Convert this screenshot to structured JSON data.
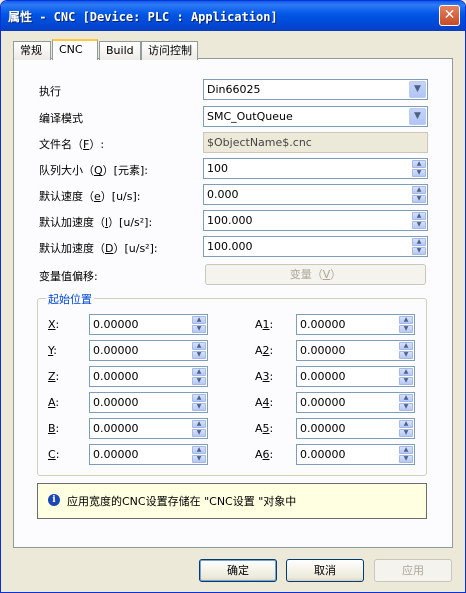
{
  "window": {
    "title": "属性 - CNC [Device: PLC : Application]",
    "close": "✕"
  },
  "tabs": [
    {
      "label": "常规",
      "active": false
    },
    {
      "label": "CNC",
      "active": true
    },
    {
      "label": "Build",
      "active": false
    },
    {
      "label": "访问控制",
      "active": false
    }
  ],
  "form": {
    "execute": {
      "label": "执行",
      "value": "Din66025"
    },
    "compile_mode": {
      "label": "编译模式",
      "value": "SMC_OutQueue"
    },
    "filename": {
      "label_pre": "文件名（",
      "label_u": "F",
      "label_post": "）:",
      "value": "$ObjectName$.cnc"
    },
    "queue_size": {
      "label_pre": "队列大小（",
      "label_u": "Q",
      "label_post": "）[元素]:",
      "value": "100"
    },
    "default_speed": {
      "label_pre": "默认速度（",
      "label_u": "e",
      "label_post": "）[u/s]:",
      "value": "0.000"
    },
    "default_accel": {
      "label_pre": "默认加速度（",
      "label_u": "l",
      "label_post": "）[u/s²]:",
      "value": "100.000"
    },
    "default_decel": {
      "label_pre": "默认加速度（",
      "label_u": "D",
      "label_post": "）[u/s²]:",
      "value": "100.000"
    },
    "var_offset": {
      "label": "变量值偏移:",
      "button_pre": "变量（",
      "button_u": "V",
      "button_post": "）"
    }
  },
  "start_position": {
    "title": "起始位置",
    "left": [
      {
        "u": "X",
        "rest": ":",
        "value": "0.00000"
      },
      {
        "u": "Y",
        "rest": ":",
        "value": "0.00000"
      },
      {
        "u": "Z",
        "rest": ":",
        "value": "0.00000"
      },
      {
        "u": "A",
        "rest": ":",
        "value": "0.00000"
      },
      {
        "u": "B",
        "rest": ":",
        "value": "0.00000"
      },
      {
        "u": "C",
        "rest": ":",
        "value": "0.00000"
      }
    ],
    "right": [
      {
        "pre": "A",
        "u": "1",
        "rest": ":",
        "value": "0.00000"
      },
      {
        "pre": "A",
        "u": "2",
        "rest": ":",
        "value": "0.00000"
      },
      {
        "pre": "A",
        "u": "3",
        "rest": ":",
        "value": "0.00000"
      },
      {
        "pre": "A",
        "u": "4",
        "rest": ":",
        "value": "0.00000"
      },
      {
        "pre": "A",
        "u": "5",
        "rest": ":",
        "value": "0.00000"
      },
      {
        "pre": "A",
        "u": "6",
        "rest": ":",
        "value": "0.00000"
      }
    ]
  },
  "info": {
    "icon": "i",
    "text": "应用宽度的CNC设置存储在 \"CNC设置 \"对象中"
  },
  "buttons": {
    "ok": "确定",
    "cancel": "取消",
    "apply": "应用"
  },
  "icons": {
    "dropdown": "▼",
    "spin_up": "▲",
    "spin_down": "▼"
  }
}
